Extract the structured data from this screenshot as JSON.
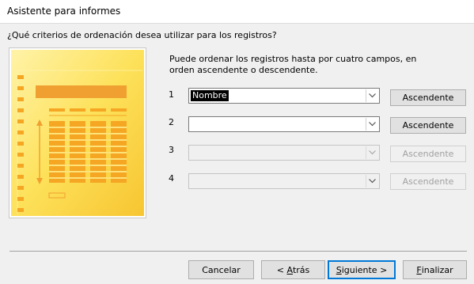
{
  "window": {
    "title": "Asistente para informes"
  },
  "question": "¿Qué criterios de ordenación desea utilizar para los registros?",
  "description": "Puede ordenar los registros hasta por cuatro campos, en orden ascendente o descendente.",
  "sort_rows": [
    {
      "number": "1",
      "field_value": "Nombre",
      "order_label": "Ascendente",
      "enabled": true
    },
    {
      "number": "2",
      "field_value": "",
      "order_label": "Ascendente",
      "enabled": true
    },
    {
      "number": "3",
      "field_value": "",
      "order_label": "Ascendente",
      "enabled": false
    },
    {
      "number": "4",
      "field_value": "",
      "order_label": "Ascendente",
      "enabled": false
    }
  ],
  "footer": {
    "cancel": "Cancelar",
    "back_prefix": "< ",
    "back_accel": "A",
    "back_rest": "trás",
    "next_accel": "S",
    "next_rest": "iguiente >",
    "finish_accel": "F",
    "finish_rest": "inalizar"
  },
  "colors": {
    "accent": "#0078d7",
    "illustration_yellow": "#fdd835",
    "illustration_orange": "#f0a030"
  },
  "icons": [
    "report-illustration-icon",
    "chevron-down-icon"
  ]
}
